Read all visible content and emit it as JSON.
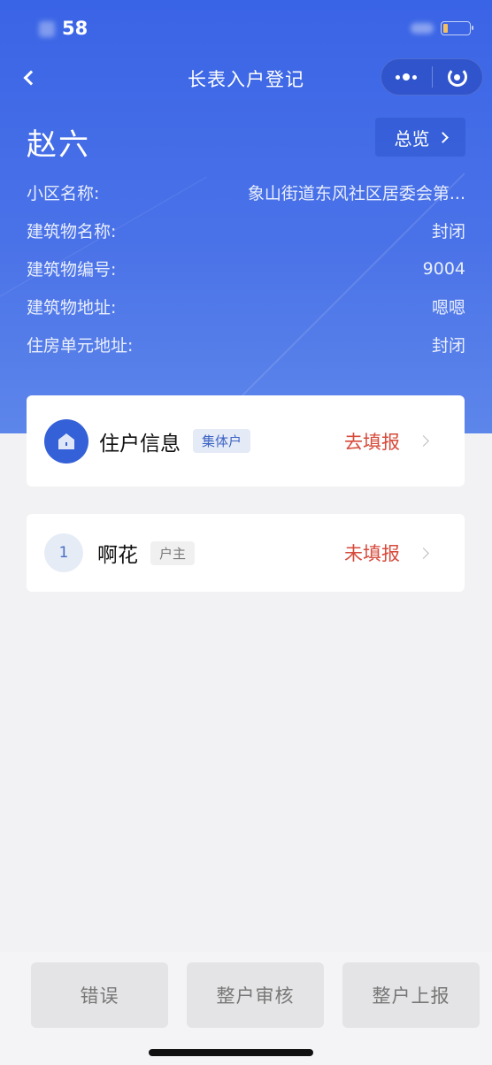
{
  "status_bar": {
    "time": "58",
    "battery_level": 0.15
  },
  "nav": {
    "title": "长表入户登记",
    "back_icon": "chevron-left-icon",
    "more_icon": "more-dots-icon",
    "close_icon": "mini-program-close-icon"
  },
  "header": {
    "name": "赵六",
    "overview_label": "总览",
    "info": [
      {
        "label": "小区名称:",
        "value": "象山街道东风社区居委会第..."
      },
      {
        "label": "建筑物名称:",
        "value": "封闭"
      },
      {
        "label": "建筑物编号:",
        "value": "9004"
      },
      {
        "label": "建筑物地址:",
        "value": "嗯嗯"
      },
      {
        "label": "住房单元地址:",
        "value": "封闭"
      }
    ]
  },
  "household_card": {
    "icon": "house-icon",
    "title": "住户信息",
    "tag": "集体户",
    "status": "去填报"
  },
  "members": [
    {
      "index": "1",
      "name": "啊花",
      "role": "户主",
      "status": "未填报"
    }
  ],
  "actions": {
    "error": "错误",
    "review": "整户审核",
    "submit": "整户上报"
  },
  "colors": {
    "primary": "#3a64e6",
    "status_red": "#d64a3b",
    "tag_blue": "#3d63c4"
  }
}
